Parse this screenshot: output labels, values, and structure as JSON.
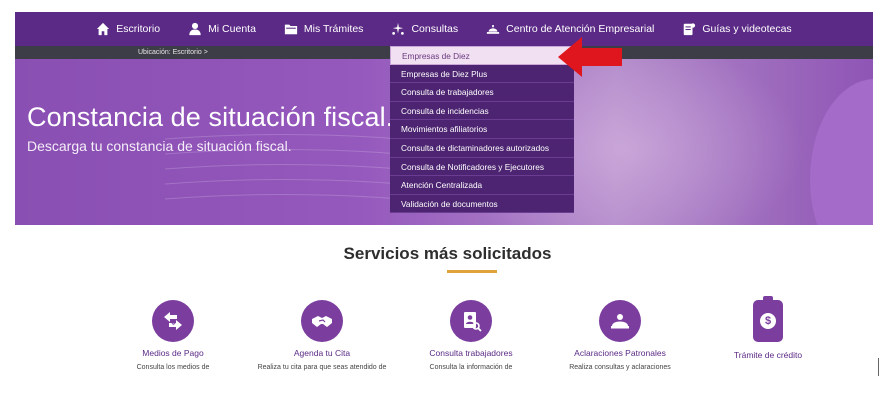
{
  "nav": {
    "items": [
      {
        "label": "Escritorio",
        "icon": "home-icon"
      },
      {
        "label": "Mi Cuenta",
        "icon": "user-icon"
      },
      {
        "label": "Mis Trámites",
        "icon": "folder-icon"
      },
      {
        "label": "Consultas",
        "icon": "sparkles-icon"
      },
      {
        "label": "Centro de Atención Empresarial",
        "icon": "service-desk-icon"
      },
      {
        "label": "Guías y videotecas",
        "icon": "guide-book-icon"
      }
    ]
  },
  "breadcrumb": {
    "text": "Ubicación: Escritorio >"
  },
  "hero": {
    "title": "Constancia de situación fiscal.",
    "subtitle": "Descarga tu constancia de situación fiscal."
  },
  "dropdown": {
    "items": [
      "Empresas de Diez",
      "Empresas de Diez Plus",
      "Consulta de trabajadores",
      "Consulta de incidencias",
      "Movimientos afiliatorios",
      "Consulta de dictaminadores autorizados",
      "Consulta de Notificadores y Ejecutores",
      "Atención Centralizada",
      "Validación de documentos"
    ]
  },
  "services": {
    "title": "Servicios más solicitados",
    "items": [
      {
        "label": "Medios de Pago",
        "desc": "Consulta los medios de",
        "icon": "payment-exchange-icon"
      },
      {
        "label": "Agenda tu Cita",
        "desc": "Realiza tu cita para que seas atendido de",
        "icon": "handshake-icon"
      },
      {
        "label": "Consulta trabajadores",
        "desc": "Consulta la información de",
        "icon": "worker-search-icon"
      },
      {
        "label": "Aclaraciones Patronales",
        "desc": "Realiza consultas y aclaraciones",
        "icon": "employer-icon"
      },
      {
        "label": "Trámite de crédito",
        "desc": "",
        "icon": "credit-clipboard-icon"
      }
    ]
  },
  "colors": {
    "nav_bg": "#5b2a86",
    "accent_underline": "#e0a23b",
    "dropdown_bg": "#4c2471",
    "arrow": "#e0161e"
  }
}
